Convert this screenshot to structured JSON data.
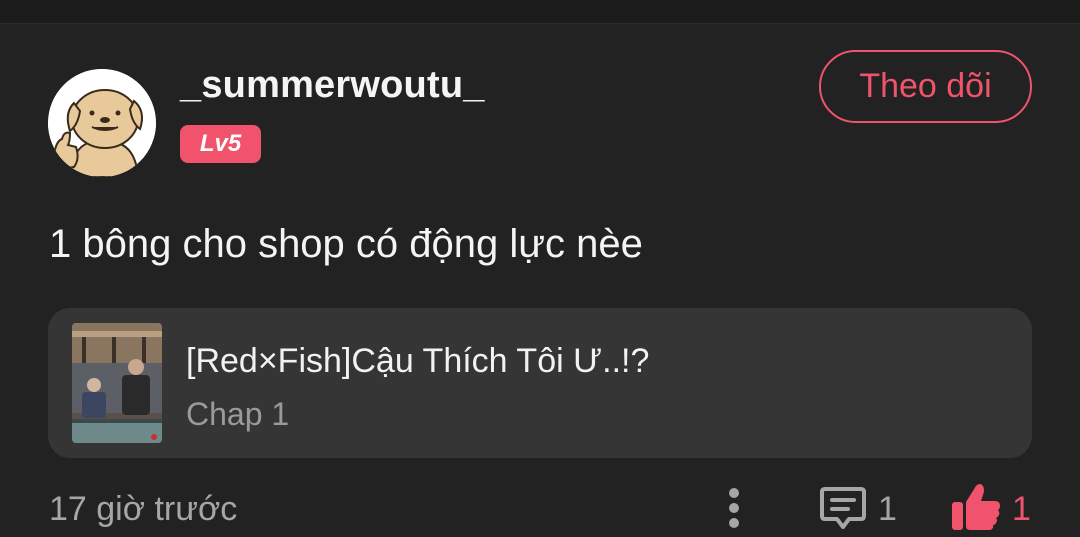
{
  "comment": {
    "username": "_summerwoutu_",
    "level": "Lv5",
    "follow_label": "Theo dõi",
    "text": "1 bông cho shop có động lực nèe",
    "timestamp": "17 giờ trước",
    "reply_count": "1",
    "like_count": "1"
  },
  "manga": {
    "title": "[Red×Fish]Cậu Thích Tôi Ư..!?",
    "chapter": "Chap 1"
  },
  "colors": {
    "background": "#222222",
    "accent": "#f0536b",
    "card": "#353535",
    "muted_text": "#a6a6a6"
  },
  "icons": [
    "avatar-dog",
    "more-vertical-icon",
    "comment-icon",
    "thumbs-up-icon"
  ]
}
